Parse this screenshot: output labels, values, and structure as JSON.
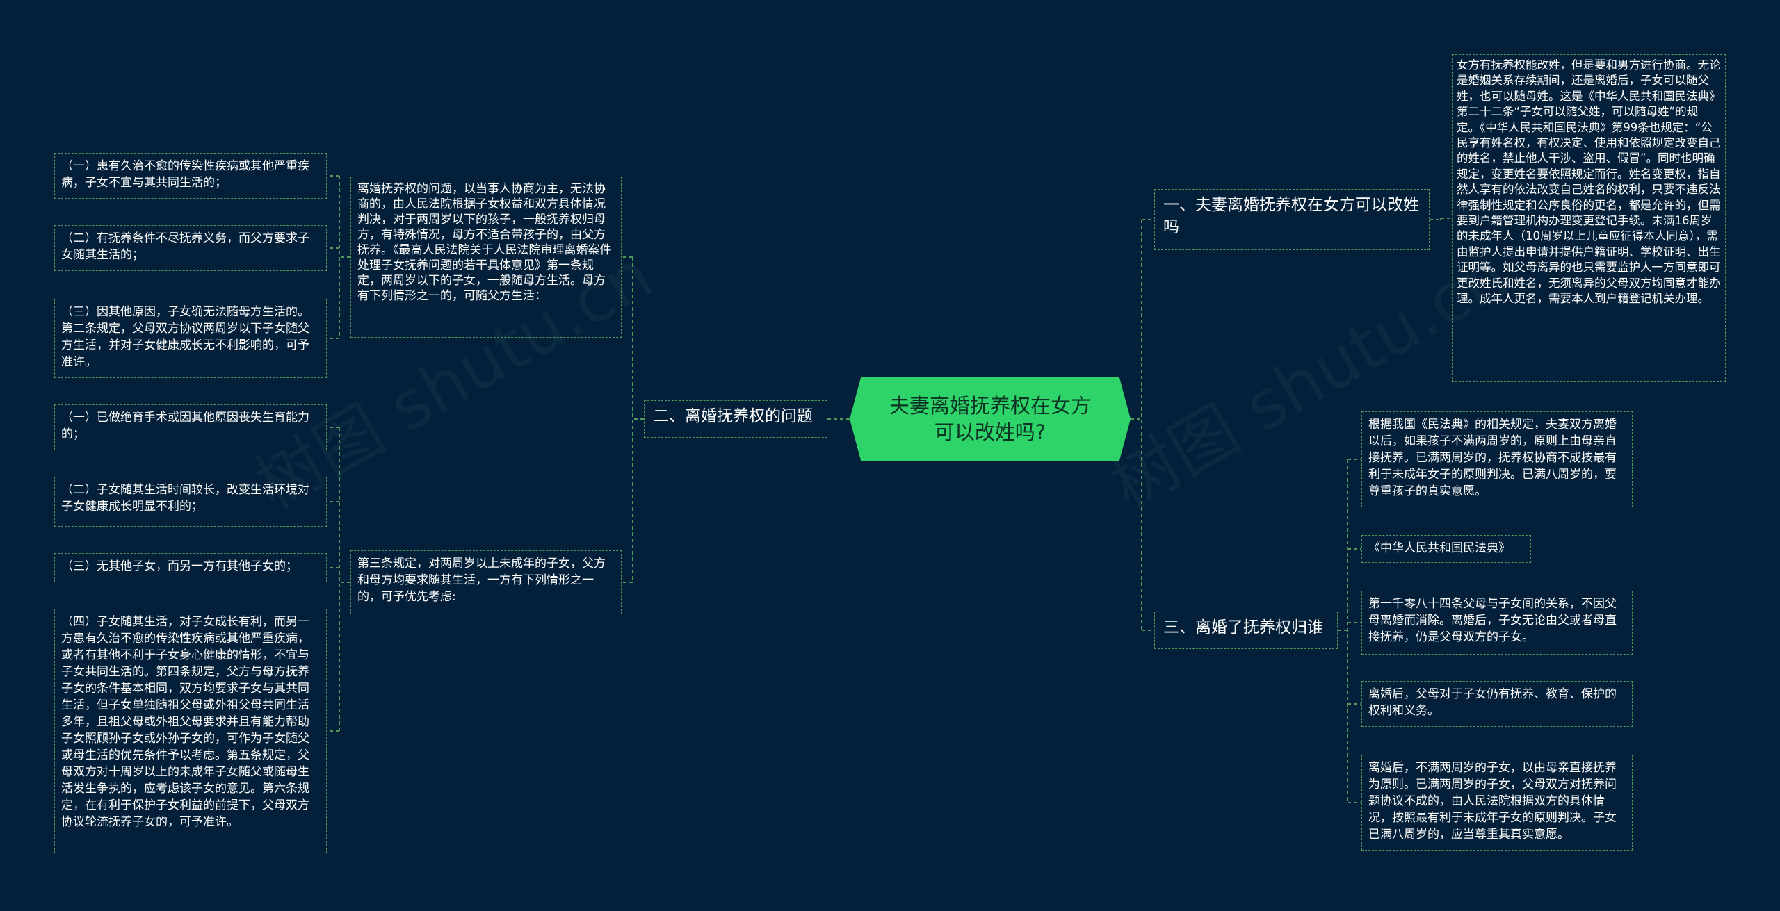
{
  "root": {
    "title": "夫妻离婚抚养权在女方可以改姓吗?"
  },
  "watermark": "树图 shutu.cn",
  "branches": [
    {
      "label": "一、夫妻离婚抚养权在女方可以改姓吗",
      "children": [
        "女方有抚养权能改姓，但是要和男方进行协商。无论是婚姻关系存续期间，还是离婚后，子女可以随父姓，也可以随母姓。这是《中华人民共和国民法典》第二十二条“子女可以随父姓，可以随母姓”的规定。《中华人民共和国民法典》第99条也规定：“公民享有姓名权，有权决定、使用和依照规定改变自己的姓名，禁止他人干涉、盗用、假冒”。同时也明确规定，变更姓名要依照规定而行。姓名变更权，指自然人享有的依法改变自己姓名的权利，只要不违反法律强制性规定和公序良俗的更名，都是允许的，但需要到户籍管理机构办理变更登记手续。未满16周岁的未成年人（10周岁以上儿童应征得本人同意），需由监护人提出申请并提供户籍证明、学校证明、出生证明等。如父母离异的也只需要监护人一方同意即可更改姓氏和姓名，无须离异的父母双方均同意才能办理。成年人更名，需要本人到户籍登记机关办理。"
      ]
    },
    {
      "label": "二、离婚抚养权的问题",
      "children": [
        {
          "text": "离婚抚养权的问题，以当事人协商为主，无法协商的，由人民法院根据子女权益和双方具体情况判决，对于两周岁以下的孩子，一般抚养权归母方，有特殊情况，母方不适合带孩子的，由父方抚养。《最高人民法院关于人民法院审理离婚案件处理子女抚养问题的若干具体意见》第一条规定，两周岁以下的子女，一般随母方生活。母方有下列情形之一的，可随父方生活：",
          "children": [
            "（一）患有久治不愈的传染性疾病或其他严重疾病，子女不宜与其共同生活的；",
            "（二）有抚养条件不尽抚养义务，而父方要求子女随其生活的；",
            "（三）因其他原因，子女确无法随母方生活的。第二条规定，父母双方协议两周岁以下子女随父方生活，并对子女健康成长无不利影响的，可予准许。"
          ]
        },
        {
          "text": "第三条规定，对两周岁以上未成年的子女，父方和母方均要求随其生活，一方有下列情形之一的，可予优先考虑:",
          "children": [
            "（一）已做绝育手术或因其他原因丧失生育能力的；",
            "（二）子女随其生活时间较长，改变生活环境对子女健康成长明显不利的；",
            "（三）无其他子女，而另一方有其他子女的；",
            "（四）子女随其生活，对子女成长有利，而另一方患有久治不愈的传染性疾病或其他严重疾病，或者有其他不利于子女身心健康的情形，不宜与子女共同生活的。第四条规定，父方与母方抚养子女的条件基本相同，双方均要求子女与其共同生活，但子女单独随祖父母或外祖父母共同生活多年，且祖父母或外祖父母要求并且有能力帮助子女照顾孙子女或外孙子女的，可作为子女随父或母生活的优先条件予以考虑。第五条规定，父母双方对十周岁以上的未成年子女随父或随母生活发生争执的，应考虑该子女的意见。第六条规定，在有利于保护子女利益的前提下，父母双方协议轮流抚养子女的，可予准许。"
          ]
        }
      ]
    },
    {
      "label": "三、离婚了抚养权归谁",
      "children": [
        "根据我国《民法典》的相关规定，夫妻双方离婚以后，如果孩子不满两周岁的，原则上由母亲直接抚养。已满两周岁的，抚养权协商不成按最有利于未成年女子的原则判决。已满八周岁的，要尊重孩子的真实意愿。",
        "《中华人民共和国民法典》",
        "第一千零八十四条父母与子女间的关系，不因父母离婚而消除。离婚后，子女无论由父或者母直接抚养，仍是父母双方的子女。",
        "离婚后，父母对于子女仍有抚养、教育、保护的权利和义务。",
        "离婚后，不满两周岁的子女，以由母亲直接抚养为原则。已满两周岁的子女，父母双方对抚养问题协议不成的，由人民法院根据双方的具体情况，按照最有利于未成年子女的原则判决。子女已满八周岁的，应当尊重其真实意愿。"
      ]
    }
  ],
  "colors": {
    "background": "#02203a",
    "root_fill": "#2ed36a",
    "connector": "#4f9a58",
    "text": "#ffffff"
  }
}
